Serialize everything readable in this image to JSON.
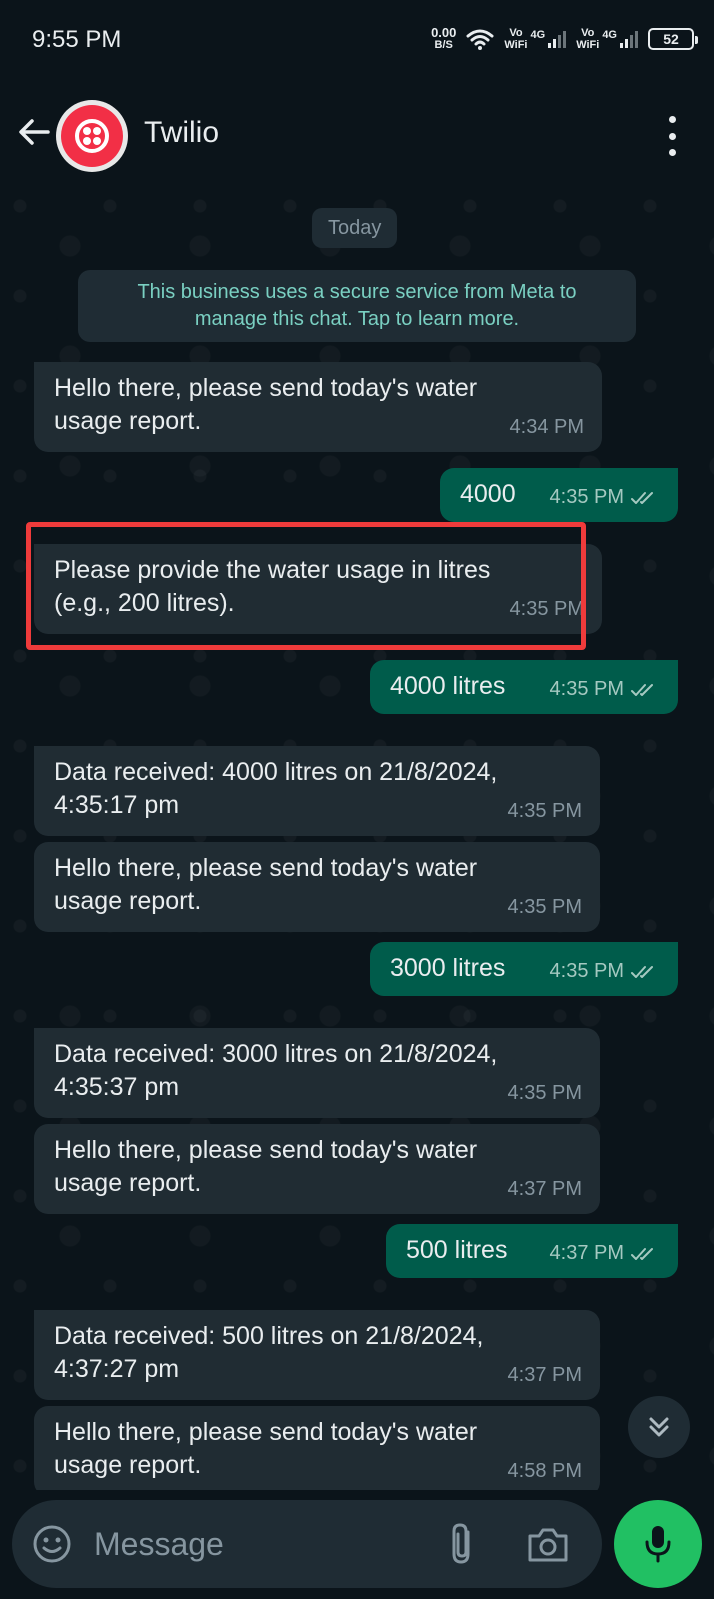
{
  "status_bar": {
    "time": "9:55 PM",
    "net_speed_value": "0.00",
    "net_speed_unit": "B/S",
    "sim1_vo": "Vo",
    "sim1_wifi": "WiFi",
    "sim1_gen": "4G",
    "sim2_vo": "Vo",
    "sim2_wifi": "WiFi",
    "sim2_gen": "4G",
    "battery": "52"
  },
  "header": {
    "contact_name": "Twilio"
  },
  "chat": {
    "day_chip": "Today",
    "business_notice_line1": "This business uses a secure service from Meta to",
    "business_notice_line2": "manage this chat. Tap to learn more.",
    "messages": [
      {
        "direction": "in",
        "line1": "Hello there, please send today's water",
        "line2": "usage report.",
        "time": "4:34 PM"
      },
      {
        "direction": "out",
        "line1": "4000",
        "time": "4:35 PM"
      },
      {
        "direction": "in",
        "line1": "Please provide the water usage in litres",
        "line2": "(e.g., 200 litres).",
        "time": "4:35 PM"
      },
      {
        "direction": "out",
        "line1": "4000 litres",
        "time": "4:35 PM"
      },
      {
        "direction": "in",
        "line1": "Data received: 4000 litres on 21/8/2024,",
        "line2": "4:35:17 pm",
        "time": "4:35 PM"
      },
      {
        "direction": "in",
        "line1": "Hello there, please send today's water",
        "line2": "usage report.",
        "time": "4:35 PM"
      },
      {
        "direction": "out",
        "line1": "3000 litres",
        "time": "4:35 PM"
      },
      {
        "direction": "in",
        "line1": "Data received: 3000 litres on 21/8/2024,",
        "line2": "4:35:37 pm",
        "time": "4:35 PM"
      },
      {
        "direction": "in",
        "line1": "Hello there, please send today's water",
        "line2": "usage report.",
        "time": "4:37 PM"
      },
      {
        "direction": "out",
        "line1": "500 litres",
        "time": "4:37 PM"
      },
      {
        "direction": "in",
        "line1": "Data received: 500 litres on 21/8/2024,",
        "line2": "4:37:27 pm",
        "time": "4:37 PM"
      },
      {
        "direction": "in",
        "line1": "Hello there, please send today's water",
        "line2": "usage report.",
        "time": "4:58 PM"
      }
    ]
  },
  "composer": {
    "placeholder": "Message"
  },
  "colors": {
    "background": "#0b141a",
    "incoming_bubble": "#202c33",
    "outgoing_bubble": "#005c4b",
    "accent_green": "#21c063",
    "highlight_red": "#ef3b3b",
    "notice_text": "#7ad0c2"
  },
  "icons": [
    "back-arrow-icon",
    "twilio-logo",
    "more-vert-icon",
    "double-check-icon",
    "chevron-double-down-icon",
    "emoji-icon",
    "paperclip-icon",
    "camera-icon",
    "mic-icon",
    "wifi-icon",
    "signal-icon",
    "battery-icon"
  ]
}
